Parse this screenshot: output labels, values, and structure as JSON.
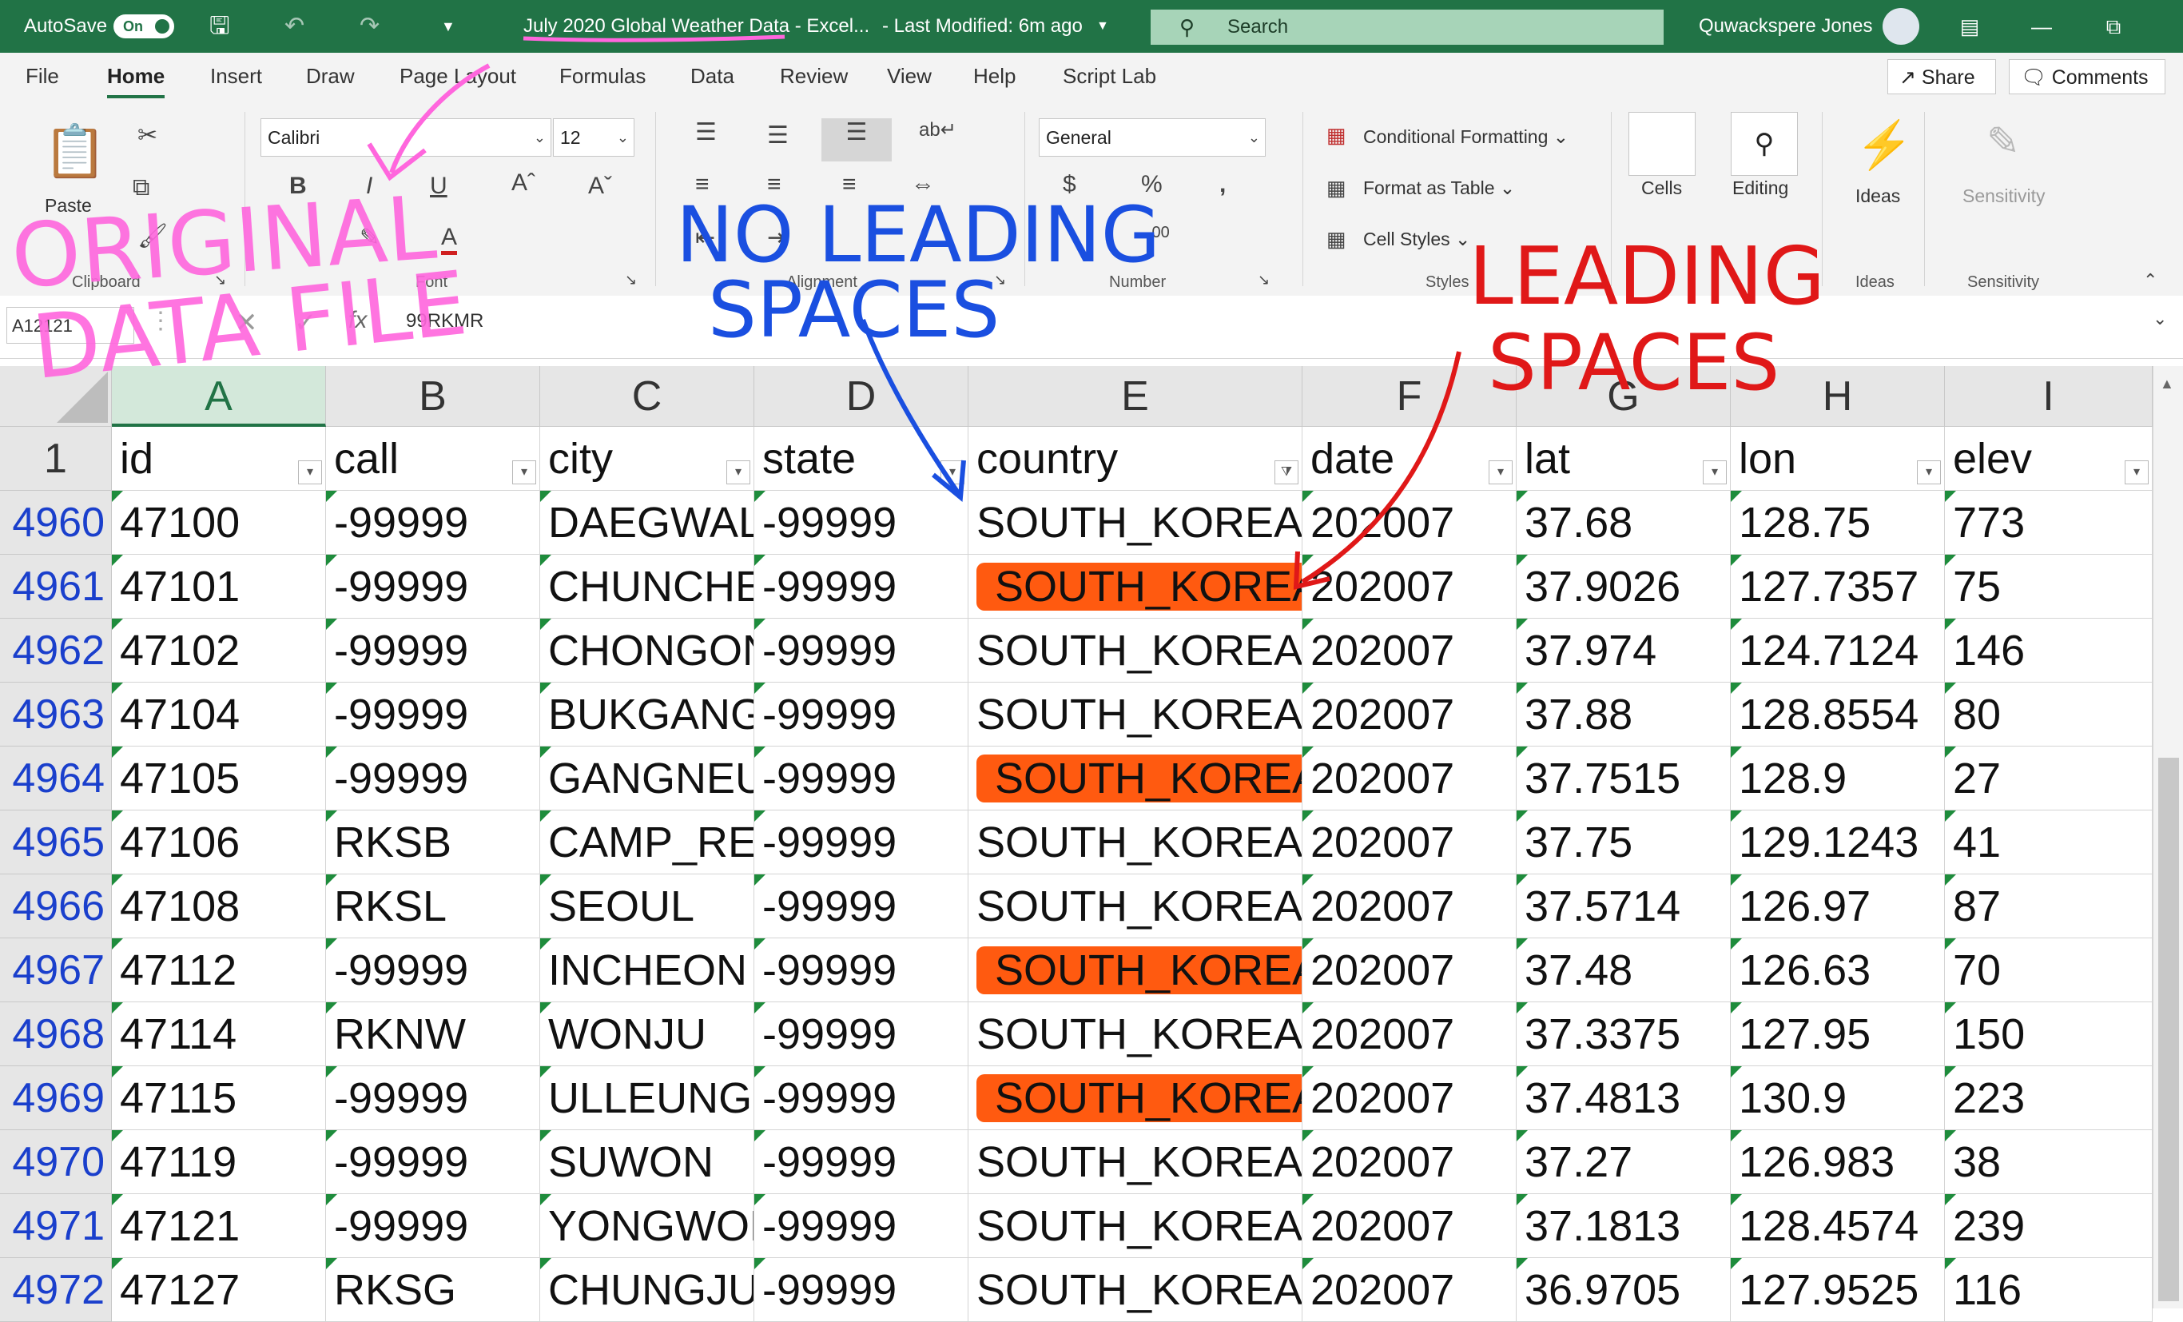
{
  "titlebar": {
    "autosave_label": "AutoSave",
    "autosave_state": "On",
    "doc_title": "July 2020 Global Weather Data",
    "doc_suffix": " - Excel...",
    "modified": "-   Last Modified: 6m ago",
    "search_placeholder": "Search",
    "user_name": "Quwackspere Jones",
    "accent": "#217346"
  },
  "tabs": [
    "File",
    "Home",
    "Insert",
    "Draw",
    "Page Layout",
    "Formulas",
    "Data",
    "Review",
    "View",
    "Help",
    "Script Lab"
  ],
  "share_label": "Share",
  "comments_label": "Comments",
  "ribbon": {
    "paste_label": "Paste",
    "clipboard_label": "Clipboard",
    "font_name": "Calibri",
    "font_size": "12",
    "font_label": "Font",
    "alignment_label": "Alignment",
    "number_format": "General",
    "number_label": "Number",
    "conditional_formatting": "Conditional Formatting",
    "format_as_table": "Format as Table",
    "cell_styles": "Cell Styles",
    "styles_label": "Styles",
    "cells_label": "Cells",
    "editing_label": "Editing",
    "ideas_button": "Ideas",
    "ideas_label": "Ideas",
    "sensitivity_button": "Sensitivity",
    "sensitivity_label": "Sensitivity"
  },
  "formula_bar": {
    "name_box": "A12121",
    "formula": "99RKMR"
  },
  "columns": [
    "A",
    "B",
    "C",
    "D",
    "E",
    "F",
    "G",
    "H",
    "I"
  ],
  "header_row": {
    "row_number": "1",
    "cells": [
      "id",
      "call",
      "city",
      "state",
      "country",
      "date",
      "lat",
      "lon",
      "elev"
    ]
  },
  "rows": [
    {
      "n": "4960",
      "c": [
        "47100",
        "-99999",
        "DAEGWAL",
        "-99999",
        "SOUTH_KOREA",
        "202007",
        "37.68",
        "128.75",
        "773"
      ],
      "hl": false
    },
    {
      "n": "4961",
      "c": [
        "47101",
        "-99999",
        "CHUNCHE(",
        "-99999",
        " SOUTH_KOREA",
        "202007",
        "37.9026",
        "127.7357",
        "75"
      ],
      "hl": true
    },
    {
      "n": "4962",
      "c": [
        "47102",
        "-99999",
        "CHONGON",
        "-99999",
        "SOUTH_KOREA",
        "202007",
        "37.974",
        "124.7124",
        "146"
      ],
      "hl": false
    },
    {
      "n": "4963",
      "c": [
        "47104",
        "-99999",
        "BUKGANG",
        "-99999",
        "SOUTH_KOREA",
        "202007",
        "37.88",
        "128.8554",
        "80"
      ],
      "hl": false
    },
    {
      "n": "4964",
      "c": [
        "47105",
        "-99999",
        "GANGNEU",
        "-99999",
        " SOUTH_KOREA",
        "202007",
        "37.7515",
        "128.9",
        "27"
      ],
      "hl": true
    },
    {
      "n": "4965",
      "c": [
        "47106",
        "RKSB",
        "CAMP_REI",
        "-99999",
        "SOUTH_KOREA",
        "202007",
        "37.75",
        "129.1243",
        "41"
      ],
      "hl": false
    },
    {
      "n": "4966",
      "c": [
        "47108",
        "RKSL",
        "SEOUL",
        "-99999",
        "SOUTH_KOREA",
        "202007",
        "37.5714",
        "126.97",
        "87"
      ],
      "hl": false
    },
    {
      "n": "4967",
      "c": [
        "47112",
        "-99999",
        "INCHEON",
        "-99999",
        " SOUTH_KOREA",
        "202007",
        "37.48",
        "126.63",
        "70"
      ],
      "hl": true
    },
    {
      "n": "4968",
      "c": [
        "47114",
        "RKNW",
        "WONJU",
        "-99999",
        "SOUTH_KOREA",
        "202007",
        "37.3375",
        "127.95",
        "150"
      ],
      "hl": false
    },
    {
      "n": "4969",
      "c": [
        "47115",
        "-99999",
        "ULLEUNGD",
        "-99999",
        " SOUTH_KOREA",
        "202007",
        "37.4813",
        "130.9",
        "223"
      ],
      "hl": true
    },
    {
      "n": "4970",
      "c": [
        "47119",
        "-99999",
        "SUWON",
        "-99999",
        "SOUTH_KOREA",
        "202007",
        "37.27",
        "126.983",
        "38"
      ],
      "hl": false
    },
    {
      "n": "4971",
      "c": [
        "47121",
        "-99999",
        "YONGWOL",
        "-99999",
        "SOUTH_KOREA",
        "202007",
        "37.1813",
        "128.4574",
        "239"
      ],
      "hl": false
    },
    {
      "n": "4972",
      "c": [
        "47127",
        "RKSG",
        "CHUNGJU",
        "-99999",
        "SOUTH_KOREA",
        "202007",
        "36.9705",
        "127.9525",
        "116"
      ],
      "hl": false
    }
  ],
  "highlight_color": "#ff5a10",
  "annotations": {
    "original_1": "ORIGINAL",
    "original_2": "DATA FILE",
    "no_leading_1": "NO LEADING",
    "no_leading_2": "SPACES",
    "leading_1": "LEADING",
    "leading_2": "SPACES",
    "pink": "#ff66dd",
    "blue": "#1a4fe0",
    "red": "#e01818"
  }
}
